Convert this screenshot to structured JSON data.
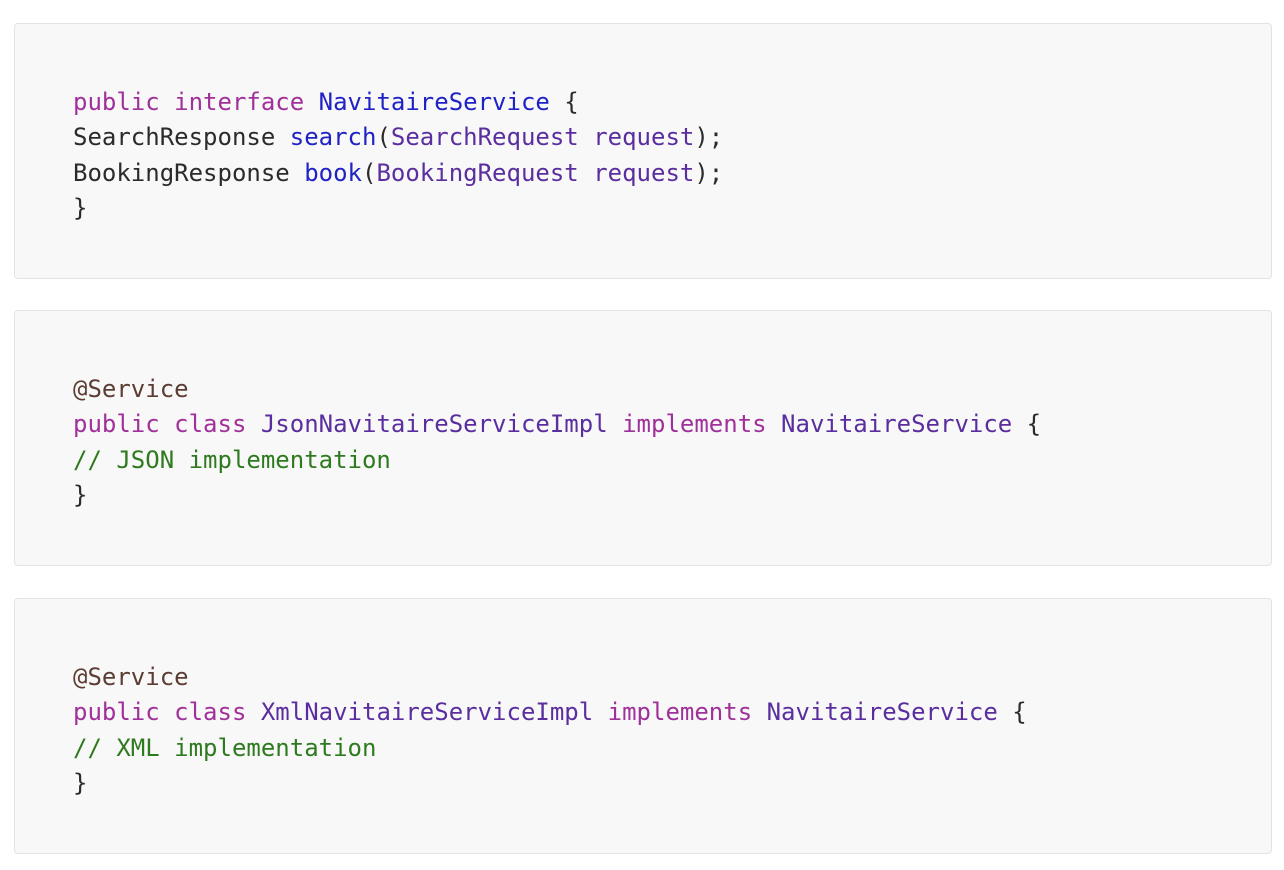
{
  "colors": {
    "background": "#ffffff",
    "block_background": "#f8f8f8",
    "block_border": "#e3e3e3",
    "keyword": "#a0309a",
    "type_definition": "#1f22c4",
    "method_name": "#1f22c4",
    "type_reference": "#5a2e9e",
    "plain": "#2b2b2b",
    "annotation": "#5b3d33",
    "comment": "#2e7a1e"
  },
  "blocks": [
    {
      "lines": [
        {
          "t0": "public",
          "t1": " ",
          "t2": "interface",
          "t3": " ",
          "t4": "NavitaireService",
          "t5": " {"
        },
        {
          "t0": "SearchResponse",
          "t1": " ",
          "t2": "search",
          "t3": "(",
          "t4": "SearchRequest",
          "t5": " ",
          "t6": "request",
          "t7": ");"
        },
        {
          "t0": "BookingResponse",
          "t1": " ",
          "t2": "book",
          "t3": "(",
          "t4": "BookingRequest",
          "t5": " ",
          "t6": "request",
          "t7": ");"
        },
        {
          "t0": "}"
        }
      ]
    },
    {
      "lines": [
        {
          "t0": "@Service"
        },
        {
          "t0": "public",
          "t1": " ",
          "t2": "class",
          "t3": " ",
          "t4": "JsonNavitaireServiceImpl",
          "t5": " ",
          "t6": "implements",
          "t7": " ",
          "t8": "NavitaireService",
          "t9": " {"
        },
        {
          "t0": "// JSON implementation"
        },
        {
          "t0": "}"
        }
      ]
    },
    {
      "lines": [
        {
          "t0": "@Service"
        },
        {
          "t0": "public",
          "t1": " ",
          "t2": "class",
          "t3": " ",
          "t4": "XmlNavitaireServiceImpl",
          "t5": " ",
          "t6": "implements",
          "t7": " ",
          "t8": "NavitaireService",
          "t9": " {"
        },
        {
          "t0": "// XML implementation"
        },
        {
          "t0": "}"
        }
      ]
    }
  ]
}
